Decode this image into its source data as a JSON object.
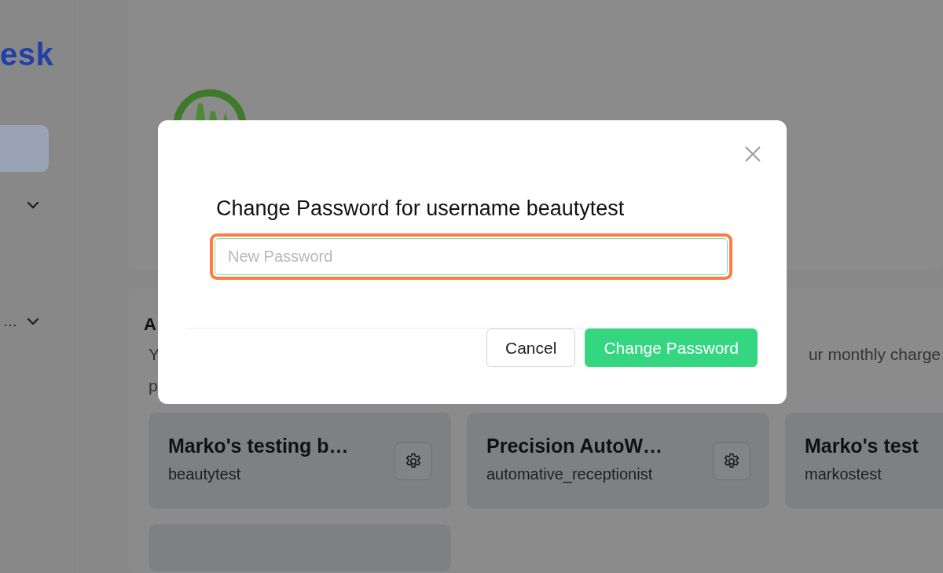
{
  "sidebar": {
    "logo_text": "esk",
    "items": [
      {
        "selected": true,
        "expandable": false
      },
      {
        "selected": false,
        "expandable": true
      },
      {
        "label": "…",
        "selected": false,
        "expandable": true
      }
    ]
  },
  "account_section": {
    "heading": "A",
    "line_1": [
      "Y",
      "ur monthly charge"
    ],
    "line_2": [
      "p"
    ],
    "accounts": [
      {
        "name": "Marko's testing b…",
        "username": "beautytest",
        "settings_button": true
      },
      {
        "name": "Precision AutoW…",
        "username": "automative_receptionist",
        "settings_button": true
      },
      {
        "name": "Marko's test",
        "username": "markostest"
      }
    ]
  },
  "modal": {
    "title": "Change Password for username beautytest",
    "field": {
      "placeholder": "New Password",
      "highlighted": true
    },
    "buttons": [
      {
        "label": "Cancel",
        "kind": "secondary"
      },
      {
        "label": "Change Password",
        "kind": "primary"
      }
    ]
  }
}
